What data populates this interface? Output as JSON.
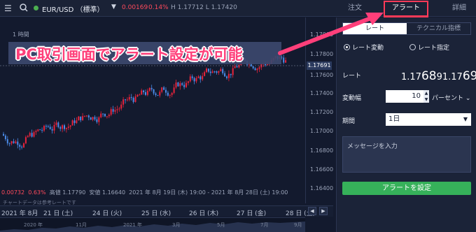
{
  "header": {
    "menu_icon": "hamburger-icon",
    "search_icon": "search-icon",
    "pair": "EUR/USD （標準）",
    "change": "0.00169",
    "change_pct": "0.14%",
    "high_low": "H 1.17712  L 1.17420",
    "tabs": {
      "order": "注文",
      "alert": "アラート",
      "detail": "詳細"
    }
  },
  "chart": {
    "interval": "1 時間",
    "y_ticks": [
      "1.17900",
      "1.17800",
      "1.17691",
      "1.17600",
      "1.17400",
      "1.17200",
      "1.17000",
      "1.16800",
      "1.16600",
      "1.16400"
    ],
    "current_price": "1.17691",
    "stats": {
      "change": "0.00732",
      "pct": "0.63%",
      "high": "高値 1.17790",
      "low": "安値 1.16640",
      "range": "2021 年 8月 19日 (木) 19:00 - 2021 年 8月 28日 (土) 19:00"
    },
    "note": "チャートデータは参考レートです",
    "x_ticks": [
      "2021 年 8月",
      "21 日 (土)",
      "24 日 (火)",
      "25 日 (水)",
      "26 日 (木)",
      "27 日 (金)",
      "28 日 (土)"
    ],
    "nav_labels": [
      "2020 年",
      "11月",
      "2021 年",
      "3月",
      "5月",
      "7月",
      "9月"
    ],
    "colors": {
      "up": "#e8233b",
      "down": "#4b8be8",
      "accent": "#ff3f7a"
    }
  },
  "callout": {
    "text": "PC取引画面でアラート設定が可能"
  },
  "panel": {
    "seg_rate": "レート",
    "seg_technical": "テクニカル指標",
    "radio_change": "レート変動",
    "radio_specify": "レート指定",
    "rate_label": "レート",
    "rate_small1": "1.17",
    "rate_big1": "68",
    "rate_small2": "9",
    "rate_small3": "1.17",
    "rate_big2": "69",
    "rate_small4": "3",
    "change_label": "変動幅",
    "change_value": "10",
    "change_unit": "パーセント",
    "period_label": "期間",
    "period_value": "1日",
    "message_placeholder": "メッセージを入力",
    "submit_label": "アラートを設定"
  }
}
